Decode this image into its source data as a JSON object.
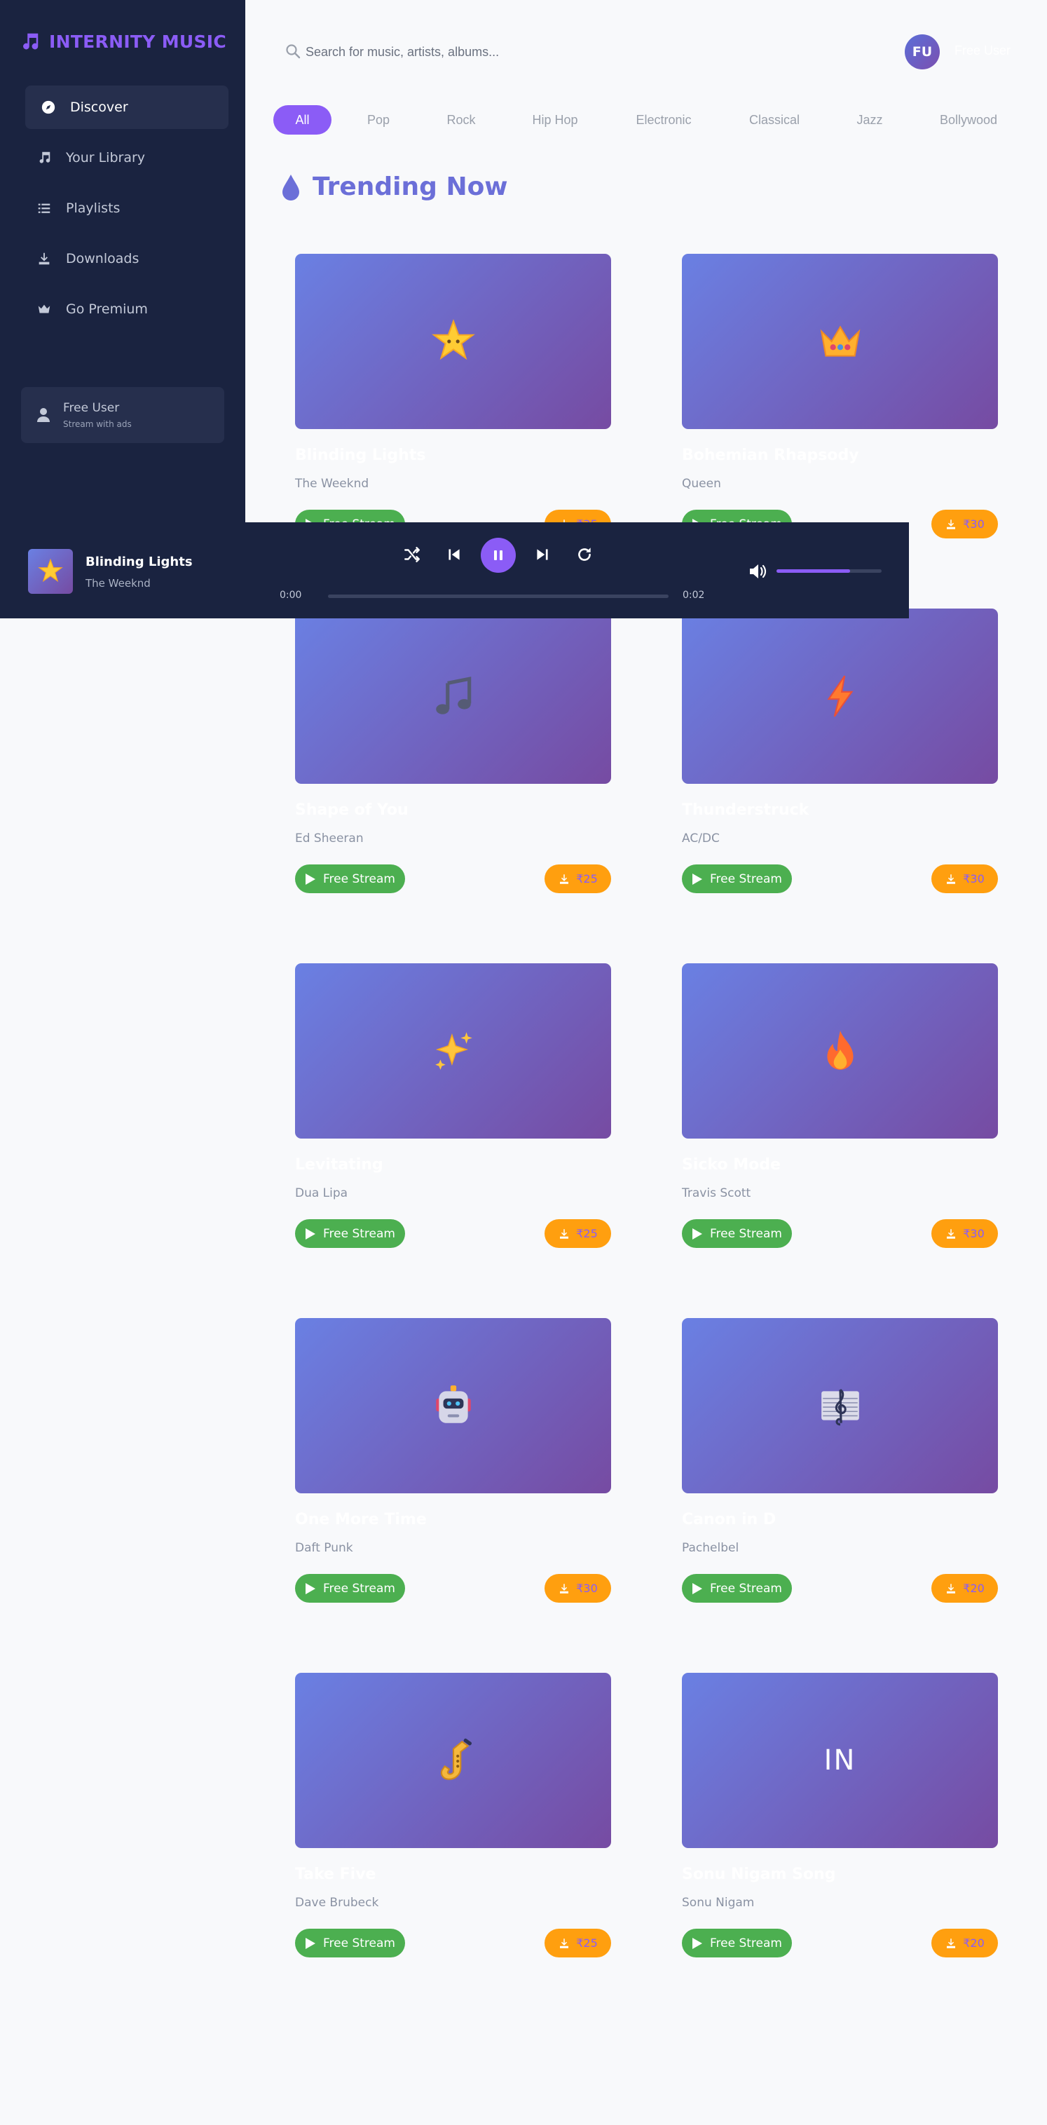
{
  "app": {
    "name": "INTERNITY MUSIC"
  },
  "sidebar": {
    "items": [
      {
        "label": "Discover",
        "icon": "compass-icon"
      },
      {
        "label": "Your Library",
        "icon": "music-note-icon"
      },
      {
        "label": "Playlists",
        "icon": "list-icon"
      },
      {
        "label": "Downloads",
        "icon": "download-icon"
      },
      {
        "label": "Go Premium",
        "icon": "crown-icon"
      }
    ],
    "user": {
      "name": "Free User",
      "subtitle": "Stream with ads"
    }
  },
  "header": {
    "search_placeholder": "Search for music, artists, albums...",
    "avatar_initials": "FU",
    "username": "Free User"
  },
  "genres": [
    "All",
    "Pop",
    "Rock",
    "Hip Hop",
    "Electronic",
    "Classical",
    "Jazz",
    "Bollywood"
  ],
  "section": {
    "title": "Trending Now"
  },
  "stream_label": "Free Stream",
  "songs": [
    {
      "title": "Blinding Lights",
      "artist": "The Weeknd",
      "price": "₹25",
      "art_icon": "star-icon"
    },
    {
      "title": "Bohemian Rhapsody",
      "artist": "Queen",
      "price": "₹30",
      "art_icon": "crown-icon"
    },
    {
      "title": "Shape of You",
      "artist": "Ed Sheeran",
      "price": "₹25",
      "art_icon": "music-notes-icon"
    },
    {
      "title": "Thunderstruck",
      "artist": "AC/DC",
      "price": "₹30",
      "art_icon": "lightning-icon"
    },
    {
      "title": "Levitating",
      "artist": "Dua Lipa",
      "price": "₹25",
      "art_icon": "sparkles-icon"
    },
    {
      "title": "Sicko Mode",
      "artist": "Travis Scott",
      "price": "₹30",
      "art_icon": "fire-icon"
    },
    {
      "title": "One More Time",
      "artist": "Daft Punk",
      "price": "₹30",
      "art_icon": "robot-icon"
    },
    {
      "title": "Canon in D",
      "artist": "Pachelbel",
      "price": "₹20",
      "art_icon": "musical-score-icon"
    },
    {
      "title": "Take Five",
      "artist": "Dave Brubeck",
      "price": "₹25",
      "art_icon": "saxophone-icon"
    },
    {
      "title": "Sonu Nigam Song",
      "artist": "Sonu Nigam",
      "price": "₹20",
      "art_initials": "IN"
    }
  ],
  "player": {
    "title": "Blinding Lights",
    "artist": "The Weeknd",
    "current_time": "0:00",
    "duration": "0:02",
    "progress": 0.0,
    "volume": 0.7
  },
  "colors": {
    "accent": "#8b5cf6",
    "sidebar": "#1a2340",
    "stream": "#4caf50",
    "price": "#ff9f0f",
    "title": "#6b6fd8"
  }
}
